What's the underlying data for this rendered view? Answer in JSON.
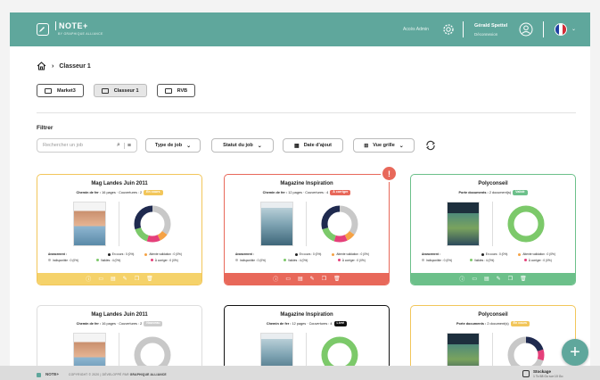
{
  "header": {
    "logo_text": "NOTE+",
    "logo_sub": "BY GRAPHIQUE ALLIANCE",
    "admin_label": "Accès Admin",
    "user_name": "Gérald Spettel",
    "logout_label": "Déconnexion",
    "language": "FR",
    "brand_color": "#5fa79c"
  },
  "breadcrumb": {
    "home_icon": "home-icon",
    "current": "Classeur 1"
  },
  "folders": [
    {
      "label": "Market3"
    },
    {
      "label": "Classeur 1"
    },
    {
      "label": "RVB"
    }
  ],
  "filters": {
    "title": "Filtrer",
    "search_placeholder": "Rechercher un job",
    "type_label": "Type de job",
    "status_label": "Statut du job",
    "date_label": "Date d'ajout",
    "view_label": "Vue grille"
  },
  "cards": [
    {
      "title": "Mag Landes Juin 2011",
      "meta_bold": "Chemin de fer :",
      "meta": " 16 pages · Couvertures : 2",
      "badge": "En cours",
      "badge_color": "#f2c65a",
      "footer_color": "#f5d26a",
      "border_color": "#f2c65a",
      "legend": {
        "title": "Avancement :",
        "items": [
          {
            "label": "En cours : 0 (0%)",
            "color": "#222222"
          },
          {
            "label": "Attente validation : 0 (0%)",
            "color": "#f5a245"
          },
          {
            "label": "Indisponible : 0 (0%)",
            "color": "#bbbbbb"
          },
          {
            "label": "Validés : 4 (0%)",
            "color": "#7cc96a"
          },
          {
            "label": "À corriger : 0 (0%)",
            "color": "#e5407a"
          }
        ]
      },
      "donut": [
        {
          "value": 35,
          "color": "#c8c8c8"
        },
        {
          "value": 8,
          "color": "#f5a245"
        },
        {
          "value": 12,
          "color": "#e5407a"
        },
        {
          "value": 15,
          "color": "#7cc96a"
        },
        {
          "value": 30,
          "color": "#1f2a4f"
        }
      ]
    },
    {
      "title": "Magazine Inspiration",
      "meta_bold": "Chemin de fer :",
      "meta": " 12 pages · Couvertures : 4",
      "badge": "À corriger",
      "badge_color": "#e8685a",
      "footer_color": "#e8685a",
      "border_color": "#e8685a",
      "legend": {
        "title": "Avancement :",
        "items": [
          {
            "label": "En cours : 0 (0%)",
            "color": "#222222"
          },
          {
            "label": "Attente validation : 0 (0%)",
            "color": "#f5a245"
          },
          {
            "label": "Indisponible : 0 (0%)",
            "color": "#bbbbbb"
          },
          {
            "label": "Validés : 4 (0%)",
            "color": "#7cc96a"
          },
          {
            "label": "À corriger : 0 (0%)",
            "color": "#e5407a"
          }
        ]
      },
      "donut": [
        {
          "value": 35,
          "color": "#c8c8c8"
        },
        {
          "value": 8,
          "color": "#f5a245"
        },
        {
          "value": 12,
          "color": "#e5407a"
        },
        {
          "value": 15,
          "color": "#7cc96a"
        },
        {
          "value": 30,
          "color": "#1f2a4f"
        }
      ]
    },
    {
      "title": "Polyconseil",
      "meta_bold": "Porte documents :",
      "meta": " 2 document(s)",
      "badge": "Validé",
      "badge_color": "#6cc08a",
      "footer_color": "#6cc08a",
      "border_color": "#6cc08a",
      "legend": {
        "title": "Avancement :",
        "items": [
          {
            "label": "En cours : 0 (0%)",
            "color": "#222222"
          },
          {
            "label": "Attente validation : 0 (0%)",
            "color": "#f5a245"
          },
          {
            "label": "Indisponible : 0 (0%)",
            "color": "#bbbbbb"
          },
          {
            "label": "Validés : 4 (0%)",
            "color": "#7cc96a"
          },
          {
            "label": "À corriger : 0 (0%)",
            "color": "#e5407a"
          }
        ]
      },
      "donut": [
        {
          "value": 100,
          "color": "#7cc96a"
        }
      ]
    },
    {
      "title": "Mag Landes Juin 2011",
      "meta_bold": "Chemin de fer :",
      "meta": " 16 pages · Couvertures : 2",
      "badge": "Nouveau",
      "badge_color": "#cccccc",
      "border_color": "#dddddd",
      "donut": [
        {
          "value": 100,
          "color": "#c8c8c8"
        }
      ]
    },
    {
      "title": "Magazine Inspiration",
      "meta_bold": "Chemin de fer :",
      "meta": " 12 pages · Couvertures : 4",
      "badge": "Livré",
      "badge_color": "#111111",
      "border_color": "#111111",
      "donut": [
        {
          "value": 100,
          "color": "#7cc96a"
        }
      ]
    },
    {
      "title": "Polyconseil",
      "meta_bold": "Porte documents :",
      "meta": " 2 document(s)",
      "badge": "En cours",
      "badge_color": "#f2c65a",
      "border_color": "#f2c65a",
      "donut": [
        {
          "value": 20,
          "color": "#1f2a4f"
        },
        {
          "value": 10,
          "color": "#e5407a"
        },
        {
          "value": 70,
          "color": "#c8c8c8"
        }
      ]
    }
  ],
  "footer": {
    "brand": "NOTE+",
    "copyright": "COPYRIGHT © 2020 | DÉVELOPPÉ PAR",
    "company": "GRAPHIQUE ALLIANCE",
    "storage_title": "Stockage",
    "storage_value": "1 To 58 Go sur 10 Go"
  }
}
